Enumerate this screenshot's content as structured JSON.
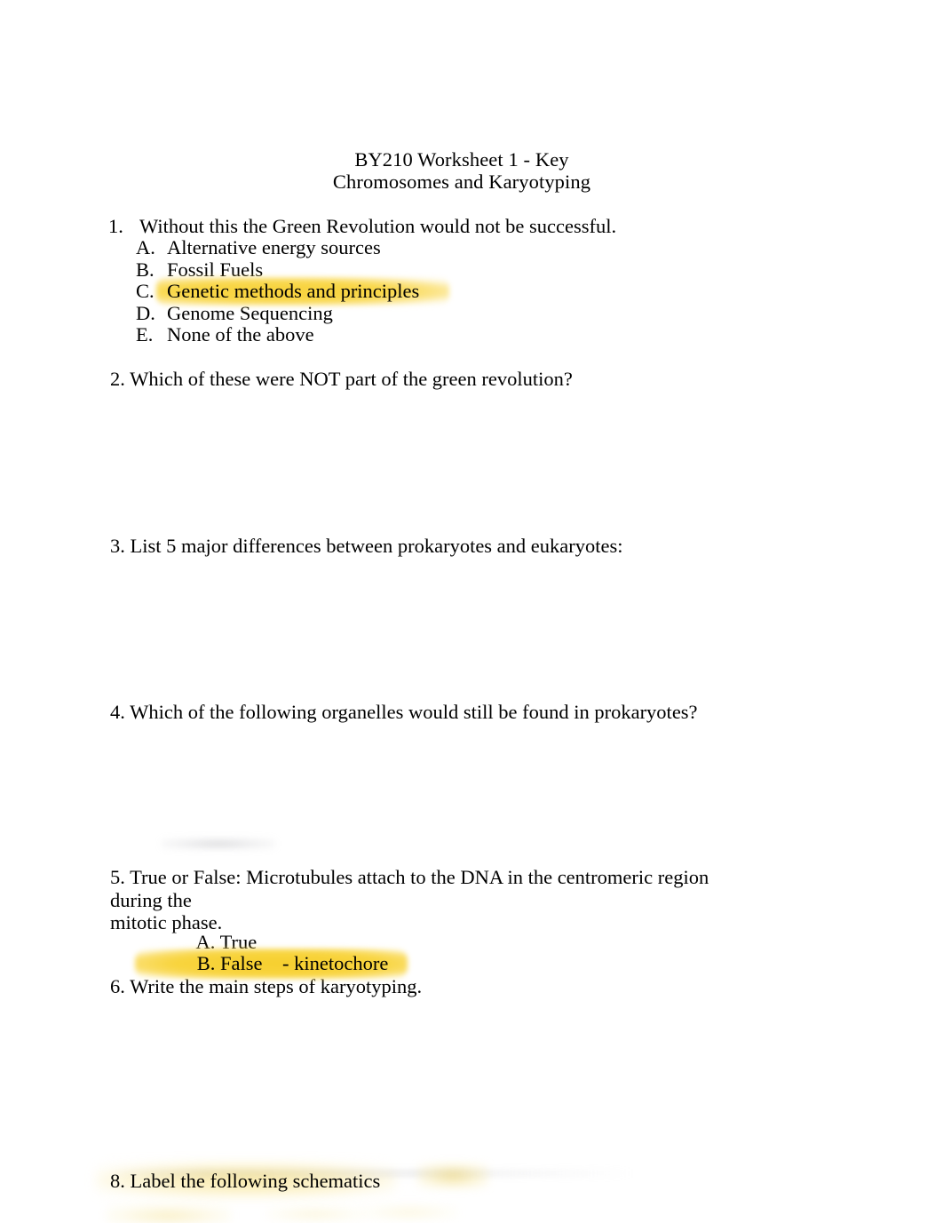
{
  "document": {
    "title_lines": [
      "BY210 Worksheet 1 - Key",
      "Chromosomes and Karyotyping"
    ]
  },
  "questions": {
    "q1": {
      "marker": "1.",
      "stem": "Without this the Green Revolution would not be successful.",
      "options": [
        {
          "marker": "A.",
          "text": "Alternative energy sources",
          "highlighted": false
        },
        {
          "marker": "B.",
          "text": "Fossil Fuels",
          "highlighted": false
        },
        {
          "marker": "C.",
          "text": "Genetic methods and principles",
          "highlighted": true
        },
        {
          "marker": "D.",
          "text": "Genome Sequencing",
          "highlighted": false
        },
        {
          "marker": "E.",
          "text": "None of the above",
          "highlighted": false
        }
      ]
    },
    "q2": {
      "text": "2. Which of these were NOT part of the green revolution?"
    },
    "q3": {
      "text": "3. List 5 major differences between prokaryotes and eukaryotes:"
    },
    "q4": {
      "text": "4. Which of the following organelles would still be found in prokaryotes?"
    },
    "q5": {
      "text": "5. True or False: Microtubules attach to the DNA in the centromeric region during the\nmitotic phase.",
      "options": [
        {
          "text": "A. True",
          "highlighted": false
        },
        {
          "text": "B. False    - kinetochore",
          "highlighted": true
        }
      ]
    },
    "q6": {
      "text": "6. Write the main steps of karyotyping."
    },
    "q8": {
      "text": "8. Label the following schematics"
    }
  },
  "colors": {
    "page_background": "#ffffff",
    "text": "#000000",
    "highlight_yellow": "#f7d23c"
  }
}
